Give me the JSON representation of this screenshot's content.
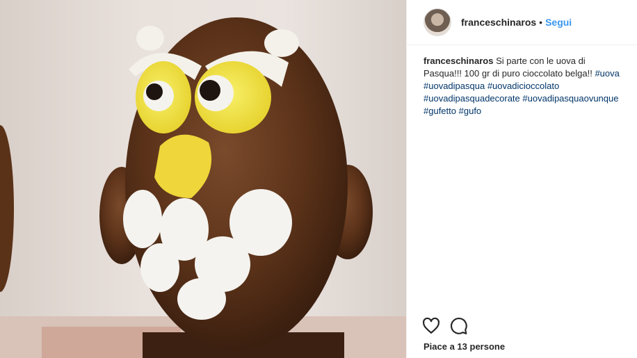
{
  "post": {
    "username": "franceschinaros",
    "separator": "•",
    "follow_label": "Segui",
    "caption_text": "Si parte con le uova di Pasqua!!! 100 gr di puro cioccolato belga!!",
    "hashtags": [
      "#uova",
      "#uovadipasqua",
      "#uovadicioccolato",
      "#uovadipasquadecorate",
      "#uovadipasquaovunque",
      "#gufetto",
      "#gufo"
    ],
    "likes_text": "Piace a 13 persone"
  },
  "icons": {
    "like": "heart-icon",
    "comment": "comment-bubble-icon"
  },
  "colors": {
    "accent": "#3897f0",
    "hashtag": "#003569",
    "text": "#262626"
  }
}
